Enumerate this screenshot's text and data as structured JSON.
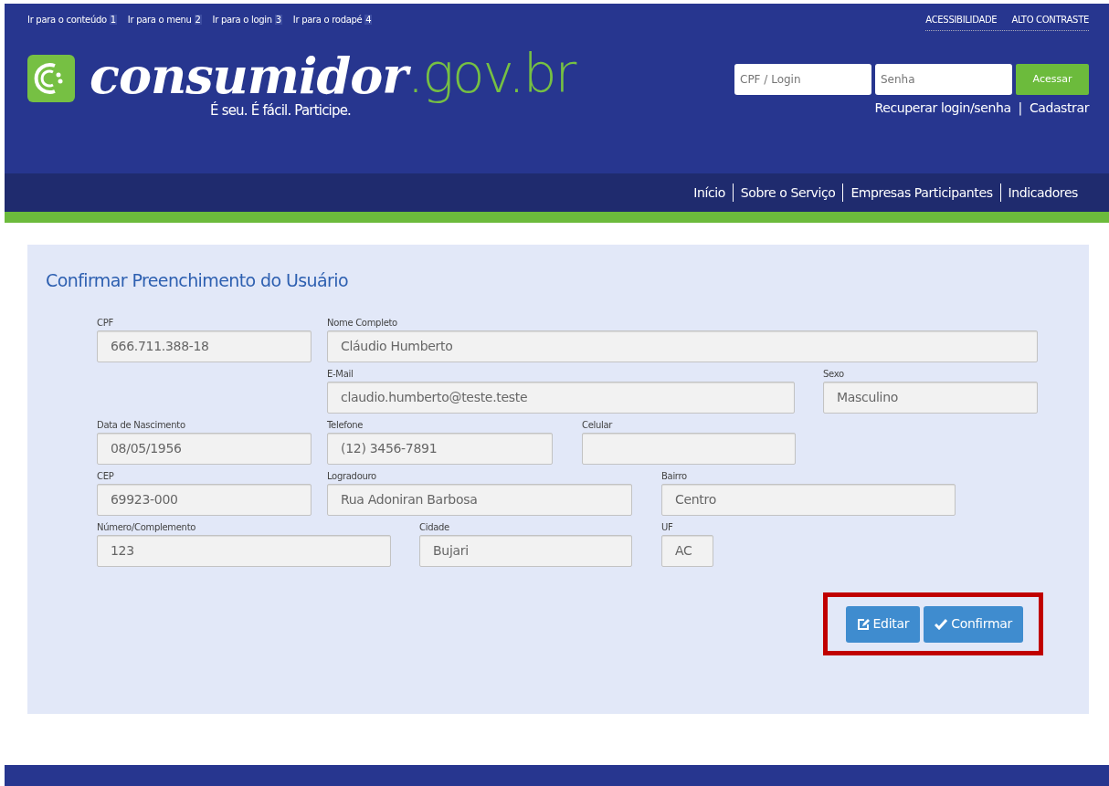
{
  "skip_links": [
    {
      "label": "Ir para o conteúdo",
      "number": "1"
    },
    {
      "label": "Ir para o menu",
      "number": "2"
    },
    {
      "label": "Ir para o login",
      "number": "3"
    },
    {
      "label": "Ir para o rodapé",
      "number": "4"
    }
  ],
  "accessibility_links": [
    "ACESSIBILIDADE",
    "ALTO CONTRASTE"
  ],
  "logo": {
    "name": "consumidor",
    "domain": ".gov.br",
    "tagline": "É seu. É fácil. Participe."
  },
  "login": {
    "user_placeholder": "CPF / Login",
    "password_placeholder": "Senha",
    "submit": "Acessar",
    "links": [
      "Recuperar login/senha",
      "Cadastrar"
    ],
    "separator": "|"
  },
  "nav": [
    "Início",
    "Sobre o Serviço",
    "Empresas Participantes",
    "Indicadores"
  ],
  "form": {
    "title": "Confirmar Preenchimento do Usuário",
    "rows": [
      [
        {
          "label": "CPF",
          "value": "666.711.388-18"
        },
        {
          "label": "Nome Completo",
          "value": "Cláudio Humberto"
        }
      ],
      [
        "",
        {
          "label": "E-Mail",
          "value": "claudio.humberto@teste.teste"
        },
        {
          "label": "Sexo",
          "value": "Masculino"
        }
      ],
      [
        {
          "label": "Data de Nascimento",
          "value": "08/05/1956"
        },
        {
          "label": "Telefone",
          "value": "(12) 3456-7891"
        },
        {
          "label": "Celular"
        }
      ],
      [
        {
          "label": "CEP",
          "value": "69923-000"
        },
        {
          "label": "Logradouro",
          "value": "Rua Adoniran Barbosa"
        },
        {
          "label": "Bairro",
          "value": "Centro"
        }
      ],
      [
        {
          "label": "Número/Complemento",
          "value": "123"
        },
        {
          "label": "Cidade",
          "value": "Bujari"
        },
        {
          "label": "UF",
          "value": "AC"
        }
      ]
    ],
    "actions_highlighted": true,
    "buttons": [
      {
        "label": "Editar",
        "kind": "edit"
      },
      {
        "label": "Confirmar",
        "kind": "confirm"
      }
    ]
  }
}
